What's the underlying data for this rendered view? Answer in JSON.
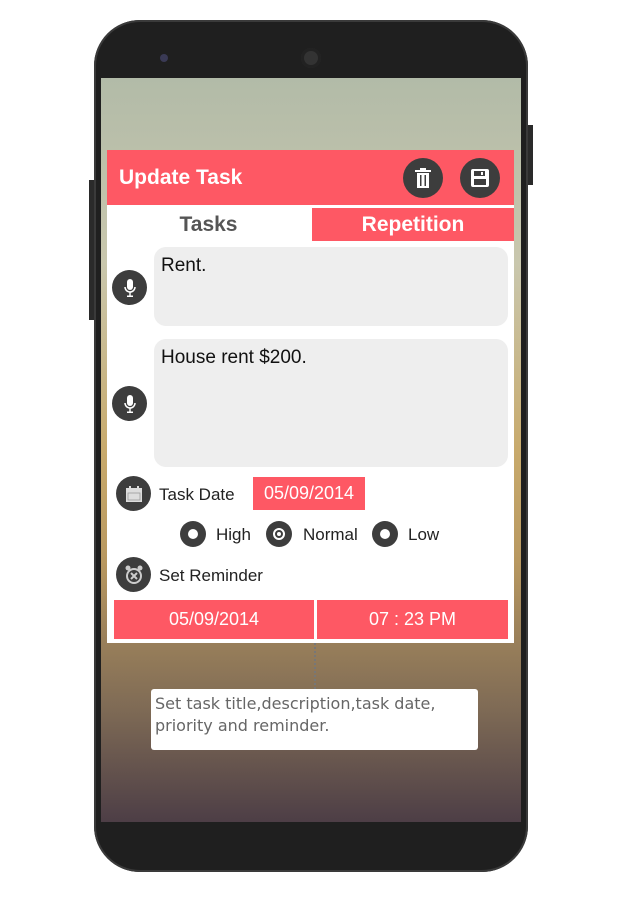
{
  "header": {
    "title": "Update Task",
    "delete_icon": "trash-icon",
    "save_icon": "floppy-disk-icon"
  },
  "tabs": [
    {
      "label": "Tasks",
      "active": false
    },
    {
      "label": "Repetition",
      "active": true
    }
  ],
  "task": {
    "title_value": "Rent.",
    "description_value": "House rent $200."
  },
  "task_date": {
    "label": "Task Date",
    "value": "05/09/2014"
  },
  "priority": {
    "options": [
      "High",
      "Normal",
      "Low"
    ],
    "selected": "Normal"
  },
  "reminder": {
    "label": "Set Reminder",
    "date": "05/09/2014",
    "time": "07 : 23 PM"
  },
  "tooltip": {
    "text": "Set task title,description,task date, priority and reminder."
  },
  "colors": {
    "accent": "#fe5864",
    "icon_bg": "#3d3d3d"
  }
}
